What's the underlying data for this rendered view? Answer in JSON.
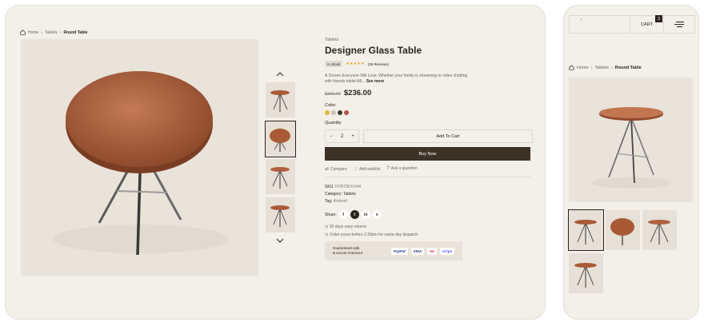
{
  "breadcrumb": {
    "home": "Home",
    "category": "Tablets",
    "current": "Round Table"
  },
  "product": {
    "category": "Tablets",
    "title": "Designer Glass Table",
    "stock": "In Stock",
    "stars": "★★★★★",
    "reviews": "(36 Reviews)",
    "description": "A Screen Everyone Will Love: Whether your family is streaming or video chatting with friends tablet A8...",
    "see_more": "See more",
    "old_price": "$320.00",
    "price": "$236.00",
    "color_label": "Color:",
    "colors": [
      "#e6b43a",
      "#c9c4bd",
      "#3a3a3a",
      "#b8504a"
    ],
    "quantity_label": "Quantity",
    "quantity": "2",
    "minus": "−",
    "plus": "+",
    "add_to_cart": "Add To Cart",
    "buy_now": "Buy Now",
    "compare": "Compare",
    "wishlist": "Add wishlist",
    "ask": "Ask a question",
    "sku_label": "SKU:",
    "sku": "NTB7SDVX44",
    "category_label": "Category:",
    "category_value": "Tablets",
    "tag_label": "Tag:",
    "tag_value": "Android",
    "share_label": "Share:",
    "share_icons": [
      "f",
      "t",
      "in",
      "v"
    ],
    "returns": "30 days easy returns",
    "dispatch": "Order yours before 2.30pm for same day dispatch",
    "guarantee_line1": "Guaranteed safe",
    "guarantee_line2": "& secure checkout",
    "payments": [
      "PayPal",
      "VISA",
      "●●",
      "stripe"
    ]
  },
  "mobile": {
    "cart_label": "CART",
    "cart_count": "3",
    "top_mark": "'"
  }
}
